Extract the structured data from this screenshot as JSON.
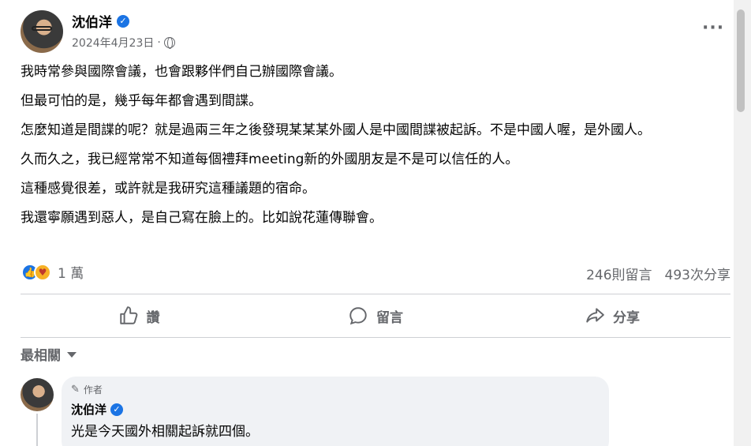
{
  "post": {
    "author": "沈伯洋",
    "date": "2024年4月23日",
    "separator": "·",
    "paragraphs": [
      "我時常參與國際會議，也會跟夥伴們自己辦國際會議。",
      "但最可怕的是，幾乎每年都會遇到間諜。",
      "怎麼知道是間諜的呢？就是過兩三年之後發現某某某外國人是中國間諜被起訴。不是中國人喔，是外國人。",
      "久而久之，我已經常常不知道每個禮拜meeting新的外國朋友是不是可以信任的人。",
      "這種感覺很差，或許就是我研究這種議題的宿命。",
      "我還寧願遇到惡人，是自己寫在臉上的。比如說花蓮傳聯會。"
    ],
    "reaction_count": "1 萬",
    "comment_count": "246則留言",
    "share_count": "493次分享"
  },
  "actions": {
    "like": "讚",
    "comment": "留言",
    "share": "分享"
  },
  "sort": {
    "label": "最相關"
  },
  "comment": {
    "badge": "作者",
    "author": "沈伯洋",
    "text": "光是今天國外相關起訴就四個。"
  },
  "colors": {
    "accent": "#1b74e4",
    "muted_text": "#65676b",
    "bubble_bg": "#f0f2f5"
  },
  "icons": [
    "verified-icon",
    "globe-icon",
    "more-icon",
    "like-reaction-icon",
    "care-reaction-icon",
    "thumbs-up-icon",
    "comment-icon",
    "share-icon",
    "chevron-down-icon",
    "pen-icon"
  ]
}
